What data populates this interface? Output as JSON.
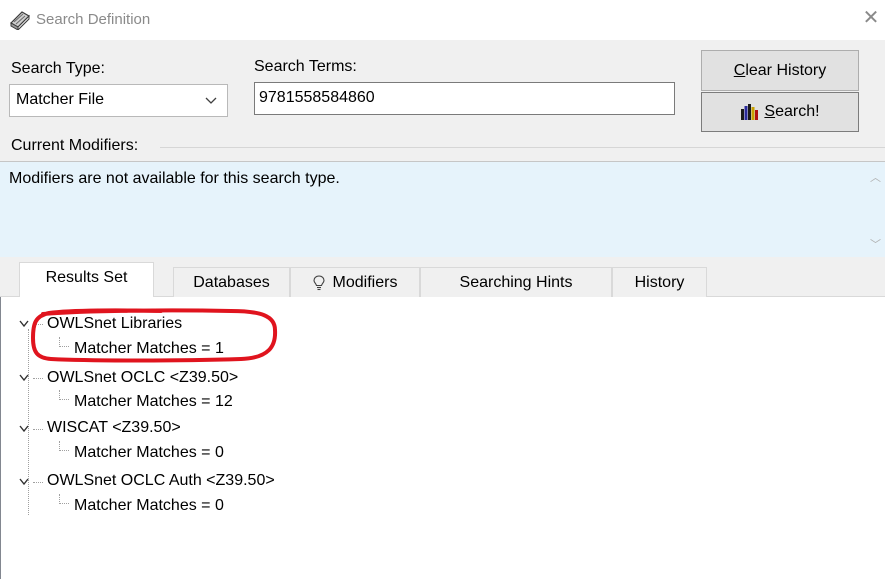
{
  "window": {
    "title": "Search Definition",
    "close_glyph": "✕"
  },
  "search_type": {
    "label": "Search Type:",
    "selected": "Matcher File"
  },
  "search_terms": {
    "label": "Search Terms:",
    "value": "9781558584860"
  },
  "buttons": {
    "clear_history": {
      "first": "C",
      "rest": "lear History"
    },
    "search": {
      "first": "S",
      "rest": "earch!"
    }
  },
  "modifiers": {
    "label": "Current Modifiers:",
    "text": "Modifiers are not available for this search type."
  },
  "tabs": [
    {
      "label": "Results Set",
      "active": true
    },
    {
      "label": "Databases",
      "active": false
    },
    {
      "label": "Modifiers",
      "active": false,
      "icon": "lightbulb-icon"
    },
    {
      "label": "Searching Hints",
      "active": false
    },
    {
      "label": "History",
      "active": false
    }
  ],
  "results": [
    {
      "database": "OWLSnet Libraries",
      "child": "Matcher Matches = 1",
      "highlighted": true
    },
    {
      "database": "OWLSnet OCLC <Z39.50>",
      "child": "Matcher Matches = 12"
    },
    {
      "database": "WISCAT <Z39.50>",
      "child": "Matcher Matches = 0"
    },
    {
      "database": "OWLSnet OCLC Auth <Z39.50>",
      "child": "Matcher Matches = 0"
    }
  ],
  "colors": {
    "annotation": "#e0141e",
    "modifiers_bg": "#e6f3fb",
    "window_bg": "#f0f0f0"
  }
}
